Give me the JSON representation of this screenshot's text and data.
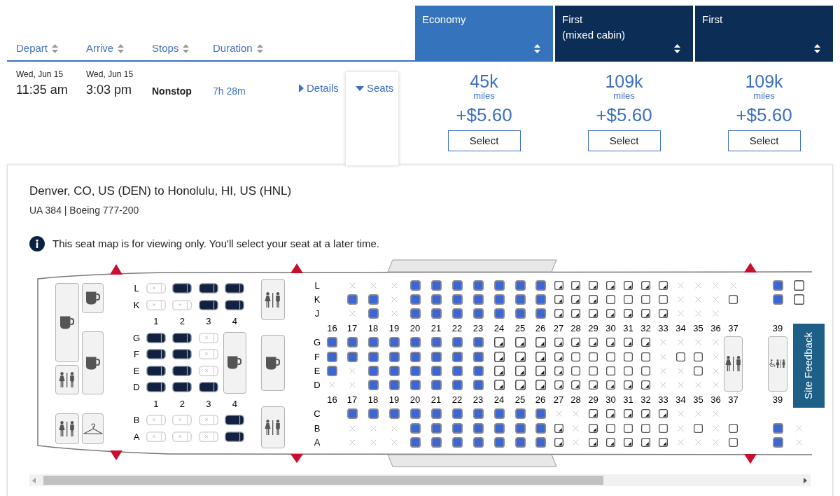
{
  "columns": [
    "Depart",
    "Arrive",
    "Stops",
    "Duration"
  ],
  "fare_columns": [
    {
      "label": "Economy",
      "selected": true
    },
    {
      "label": "First",
      "note": "(mixed cabin)",
      "selected": false
    },
    {
      "label": "First",
      "selected": false
    }
  ],
  "flight": {
    "depart": {
      "date": "Wed, Jun 15",
      "time": "11:35 am"
    },
    "arrive": {
      "date": "Wed, Jun 15",
      "time": "3:03 pm"
    },
    "stops": "Nonstop",
    "duration": "7h 28m",
    "details": {
      "label": "Details",
      "expanded": false
    },
    "seats": {
      "label": "Seats",
      "expanded": true
    }
  },
  "fares": [
    {
      "miles": "45k",
      "unit": "miles",
      "price": "+$5.60",
      "button": "Select"
    },
    {
      "miles": "109k",
      "unit": "miles",
      "price": "+$5.60",
      "button": "Select"
    },
    {
      "miles": "109k",
      "unit": "miles",
      "price": "+$5.60",
      "button": "Select"
    }
  ],
  "seat_map": {
    "route": "Denver, CO, US (DEN) to Honolulu, HI, US (HNL)",
    "flight_info": "UA 384 | Boeing 777-200",
    "notice": "This seat map is for viewing only. You'll select your seat at a later time.",
    "first_cabin": {
      "lines": [
        {
          "kind": "seats",
          "letter": "L",
          "seats": [
            {
              "kind": "taken"
            },
            {
              "kind": "open"
            },
            {
              "kind": "open"
            },
            {
              "kind": "open"
            }
          ]
        },
        {
          "kind": "seats",
          "letter": "K",
          "seats": [
            {
              "kind": "taken"
            },
            {
              "kind": "taken"
            },
            {
              "kind": "open"
            },
            {
              "kind": "open"
            }
          ]
        },
        {
          "kind": "numbers",
          "labels": [
            "1",
            "2",
            "3",
            "4"
          ]
        },
        {
          "kind": "seats",
          "letter": "G",
          "seats": [
            {
              "kind": "open"
            },
            {
              "kind": "open"
            },
            {
              "kind": "taken"
            }
          ]
        },
        {
          "kind": "seats",
          "letter": "F",
          "seats": [
            {
              "kind": "open"
            },
            {
              "kind": "open"
            },
            {
              "kind": "taken"
            }
          ]
        },
        {
          "kind": "seats",
          "letter": "E",
          "seats": [
            {
              "kind": "open"
            },
            {
              "kind": "open"
            },
            {
              "kind": "taken"
            }
          ]
        },
        {
          "kind": "seats",
          "letter": "D",
          "seats": [
            {
              "kind": "open"
            },
            {
              "kind": "open"
            },
            {
              "kind": "open"
            }
          ]
        },
        {
          "kind": "numbers",
          "labels": [
            "1",
            "2",
            "3",
            "4"
          ]
        },
        {
          "kind": "seats",
          "letter": "B",
          "seats": [
            {
              "kind": "taken"
            },
            {
              "kind": "taken"
            },
            {
              "kind": "taken"
            },
            {
              "kind": "open"
            }
          ]
        },
        {
          "kind": "seats",
          "letter": "A",
          "seats": [
            {
              "kind": "taken"
            },
            {
              "kind": "taken"
            },
            {
              "kind": "taken"
            },
            {
              "kind": "open"
            }
          ]
        }
      ]
    },
    "economy_cabin": {
      "lines": [
        {
          "kind": "seats",
          "letter": "L",
          "seats": [
            {
              "kind": "gap"
            },
            {
              "kind": "taken"
            },
            {
              "kind": "taken"
            },
            {
              "kind": "taken"
            },
            {
              "kind": "plus"
            },
            {
              "kind": "plus"
            },
            {
              "kind": "plus"
            },
            {
              "kind": "plus"
            },
            {
              "kind": "plus"
            },
            {
              "kind": "plus"
            },
            {
              "kind": "plus"
            },
            {
              "kind": "preferred"
            },
            {
              "kind": "preferred"
            },
            {
              "kind": "preferred"
            },
            {
              "kind": "preferred"
            },
            {
              "kind": "preferred"
            },
            {
              "kind": "preferred"
            },
            {
              "kind": "preferred"
            },
            {
              "kind": "taken"
            },
            {
              "kind": "taken"
            },
            {
              "kind": "taken"
            },
            {
              "kind": "taken"
            },
            {
              "kind": "plus"
            },
            {
              "kind": "open"
            }
          ]
        },
        {
          "kind": "seats",
          "letter": "K",
          "seats": [
            {
              "kind": "gap"
            },
            {
              "kind": "plus"
            },
            {
              "kind": "plus"
            },
            {
              "kind": "taken"
            },
            {
              "kind": "plus"
            },
            {
              "kind": "plus"
            },
            {
              "kind": "plus"
            },
            {
              "kind": "plus"
            },
            {
              "kind": "plus"
            },
            {
              "kind": "plus"
            },
            {
              "kind": "plus"
            },
            {
              "kind": "preferred"
            },
            {
              "kind": "preferred"
            },
            {
              "kind": "preferred"
            },
            {
              "kind": "open"
            },
            {
              "kind": "open"
            },
            {
              "kind": "open"
            },
            {
              "kind": "open"
            },
            {
              "kind": "taken"
            },
            {
              "kind": "taken"
            },
            {
              "kind": "taken"
            },
            {
              "kind": "open"
            },
            {
              "kind": "plus"
            },
            {
              "kind": "open"
            }
          ]
        },
        {
          "kind": "seats",
          "letter": "J",
          "seats": [
            {
              "kind": "gap"
            },
            {
              "kind": "taken"
            },
            {
              "kind": "plus"
            },
            {
              "kind": "taken"
            },
            {
              "kind": "plus"
            },
            {
              "kind": "plus"
            },
            {
              "kind": "plus"
            },
            {
              "kind": "plus"
            },
            {
              "kind": "plus"
            },
            {
              "kind": "plus"
            },
            {
              "kind": "plus"
            },
            {
              "kind": "preferred"
            },
            {
              "kind": "preferred"
            },
            {
              "kind": "preferred"
            },
            {
              "kind": "preferred"
            },
            {
              "kind": "preferred"
            },
            {
              "kind": "preferred"
            },
            {
              "kind": "preferred"
            },
            {
              "kind": "taken"
            },
            {
              "kind": "taken"
            },
            {
              "kind": "taken"
            }
          ]
        },
        {
          "kind": "numbers",
          "labels": [
            "16",
            "17",
            "18",
            "19",
            "20",
            "21",
            "22",
            "23",
            "24",
            "25",
            "26",
            "27",
            "28",
            "29",
            "30",
            "31",
            "32",
            "33",
            "34",
            "35",
            "36",
            "37",
            "39"
          ]
        },
        {
          "kind": "seats",
          "letter": "G",
          "seats": [
            {
              "kind": "plus"
            },
            {
              "kind": "plus"
            },
            {
              "kind": "plus"
            },
            {
              "kind": "plus"
            },
            {
              "kind": "plus"
            },
            {
              "kind": "plus"
            },
            {
              "kind": "plus"
            },
            {
              "kind": "plus"
            },
            {
              "kind": "preferred"
            },
            {
              "kind": "preferred"
            },
            {
              "kind": "preferred"
            },
            {
              "kind": "preferred"
            },
            {
              "kind": "preferred"
            },
            {
              "kind": "preferred"
            },
            {
              "kind": "preferred"
            },
            {
              "kind": "preferred"
            },
            {
              "kind": "preferred"
            },
            {
              "kind": "taken"
            },
            {
              "kind": "taken"
            },
            {
              "kind": "taken"
            },
            {
              "kind": "taken"
            }
          ]
        },
        {
          "kind": "seats",
          "letter": "F",
          "seats": [
            {
              "kind": "plus"
            },
            {
              "kind": "plus"
            },
            {
              "kind": "plus"
            },
            {
              "kind": "plus"
            },
            {
              "kind": "plus"
            },
            {
              "kind": "plus"
            },
            {
              "kind": "plus"
            },
            {
              "kind": "plus"
            },
            {
              "kind": "preferred"
            },
            {
              "kind": "preferred"
            },
            {
              "kind": "preferred"
            },
            {
              "kind": "preferred"
            },
            {
              "kind": "open"
            },
            {
              "kind": "open"
            },
            {
              "kind": "open"
            },
            {
              "kind": "open"
            },
            {
              "kind": "open"
            },
            {
              "kind": "taken"
            },
            {
              "kind": "open"
            },
            {
              "kind": "open"
            },
            {
              "kind": "taken"
            }
          ]
        },
        {
          "kind": "seats",
          "letter": "E",
          "seats": [
            {
              "kind": "plus"
            },
            {
              "kind": "taken"
            },
            {
              "kind": "plus"
            },
            {
              "kind": "plus"
            },
            {
              "kind": "plus"
            },
            {
              "kind": "plus"
            },
            {
              "kind": "plus"
            },
            {
              "kind": "plus"
            },
            {
              "kind": "preferred"
            },
            {
              "kind": "preferred"
            },
            {
              "kind": "preferred"
            },
            {
              "kind": "preferred"
            },
            {
              "kind": "open"
            },
            {
              "kind": "open"
            },
            {
              "kind": "open"
            },
            {
              "kind": "open"
            },
            {
              "kind": "open"
            },
            {
              "kind": "taken"
            },
            {
              "kind": "taken"
            },
            {
              "kind": "open"
            },
            {
              "kind": "taken"
            }
          ]
        },
        {
          "kind": "seats",
          "letter": "D",
          "seats": [
            {
              "kind": "taken"
            },
            {
              "kind": "taken"
            },
            {
              "kind": "plus"
            },
            {
              "kind": "plus"
            },
            {
              "kind": "plus"
            },
            {
              "kind": "plus"
            },
            {
              "kind": "plus"
            },
            {
              "kind": "plus"
            },
            {
              "kind": "preferred"
            },
            {
              "kind": "preferred"
            },
            {
              "kind": "preferred"
            },
            {
              "kind": "preferred"
            },
            {
              "kind": "preferred"
            },
            {
              "kind": "preferred"
            },
            {
              "kind": "preferred"
            },
            {
              "kind": "preferred"
            },
            {
              "kind": "preferred"
            },
            {
              "kind": "taken"
            },
            {
              "kind": "taken"
            },
            {
              "kind": "taken"
            },
            {
              "kind": "taken"
            }
          ]
        },
        {
          "kind": "numbers",
          "labels": [
            "16",
            "17",
            "18",
            "19",
            "20",
            "21",
            "22",
            "23",
            "24",
            "25",
            "26",
            "27",
            "28",
            "29",
            "30",
            "31",
            "32",
            "33",
            "34",
            "35",
            "36",
            "37",
            "39"
          ]
        },
        {
          "kind": "seats",
          "letter": "C",
          "seats": [
            {
              "kind": "gap"
            },
            {
              "kind": "plus"
            },
            {
              "kind": "plus"
            },
            {
              "kind": "plus"
            },
            {
              "kind": "plus"
            },
            {
              "kind": "plus"
            },
            {
              "kind": "plus"
            },
            {
              "kind": "plus"
            },
            {
              "kind": "plus"
            },
            {
              "kind": "plus"
            },
            {
              "kind": "plus"
            },
            {
              "kind": "taken"
            },
            {
              "kind": "taken"
            },
            {
              "kind": "preferred"
            },
            {
              "kind": "preferred"
            },
            {
              "kind": "preferred"
            },
            {
              "kind": "preferred"
            },
            {
              "kind": "preferred"
            },
            {
              "kind": "taken"
            },
            {
              "kind": "taken"
            },
            {
              "kind": "taken"
            }
          ]
        },
        {
          "kind": "seats",
          "letter": "B",
          "seats": [
            {
              "kind": "gap"
            },
            {
              "kind": "taken"
            },
            {
              "kind": "taken"
            },
            {
              "kind": "taken"
            },
            {
              "kind": "plus"
            },
            {
              "kind": "plus"
            },
            {
              "kind": "plus"
            },
            {
              "kind": "plus"
            },
            {
              "kind": "plus"
            },
            {
              "kind": "plus"
            },
            {
              "kind": "plus"
            },
            {
              "kind": "preferred"
            },
            {
              "kind": "taken"
            },
            {
              "kind": "preferred"
            },
            {
              "kind": "open"
            },
            {
              "kind": "open"
            },
            {
              "kind": "open"
            },
            {
              "kind": "open"
            },
            {
              "kind": "taken"
            },
            {
              "kind": "open"
            },
            {
              "kind": "taken"
            },
            {
              "kind": "open"
            },
            {
              "kind": "plus"
            },
            {
              "kind": "taken"
            }
          ]
        },
        {
          "kind": "seats",
          "letter": "A",
          "seats": [
            {
              "kind": "gap"
            },
            {
              "kind": "taken"
            },
            {
              "kind": "taken"
            },
            {
              "kind": "taken"
            },
            {
              "kind": "plus"
            },
            {
              "kind": "plus"
            },
            {
              "kind": "plus"
            },
            {
              "kind": "plus"
            },
            {
              "kind": "plus"
            },
            {
              "kind": "plus"
            },
            {
              "kind": "plus"
            },
            {
              "kind": "preferred"
            },
            {
              "kind": "taken"
            },
            {
              "kind": "preferred"
            },
            {
              "kind": "preferred"
            },
            {
              "kind": "preferred"
            },
            {
              "kind": "preferred"
            },
            {
              "kind": "preferred"
            },
            {
              "kind": "taken"
            },
            {
              "kind": "taken"
            },
            {
              "kind": "taken"
            },
            {
              "kind": "open"
            },
            {
              "kind": "plus"
            },
            {
              "kind": "taken"
            }
          ]
        }
      ]
    }
  },
  "feedback_tab": "Site Feedback"
}
